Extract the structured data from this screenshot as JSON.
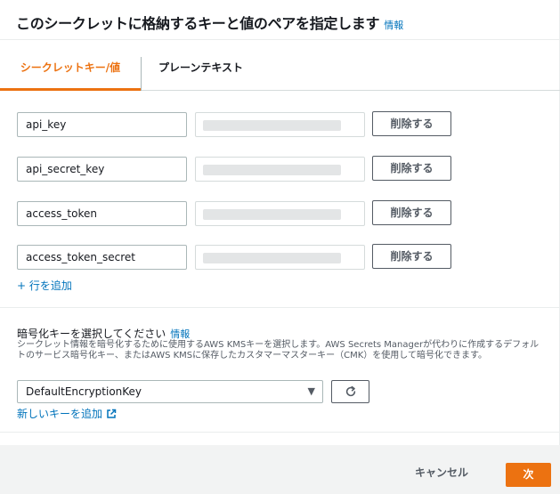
{
  "header": {
    "title": "このシークレットに格納するキーと値のペアを指定します",
    "info_link": "情報"
  },
  "tabs": [
    {
      "label": "シークレットキー/値",
      "active": true
    },
    {
      "label": "プレーンテキスト",
      "active": false
    }
  ],
  "rows": [
    {
      "key": "api_key",
      "value_masked": true,
      "delete_label": "削除する"
    },
    {
      "key": "api_secret_key",
      "value_masked": true,
      "delete_label": "削除する"
    },
    {
      "key": "access_token",
      "value_masked": true,
      "delete_label": "削除する"
    },
    {
      "key": "access_token_secret",
      "value_masked": true,
      "delete_label": "削除する"
    }
  ],
  "add_row_label": "+ 行を追加",
  "encryption": {
    "label": "暗号化キーを選択してください",
    "info_link": "情報",
    "description": "シークレット情報を暗号化するために使用するAWS KMSキーを選択します。AWS Secrets Managerが代わりに作成するデフォルトのサービス暗号化キー、またはAWS KMSに保存したカスタマーマスターキー（CMK）を使用して暗号化できます。",
    "selected_key": "DefaultEncryptionKey",
    "new_key_link": "新しいキーを追加"
  },
  "footer": {
    "cancel_label": "キャンセル",
    "next_label": "次"
  },
  "colors": {
    "accent": "#ec7211",
    "link": "#0073bb",
    "text": "#16191f"
  }
}
